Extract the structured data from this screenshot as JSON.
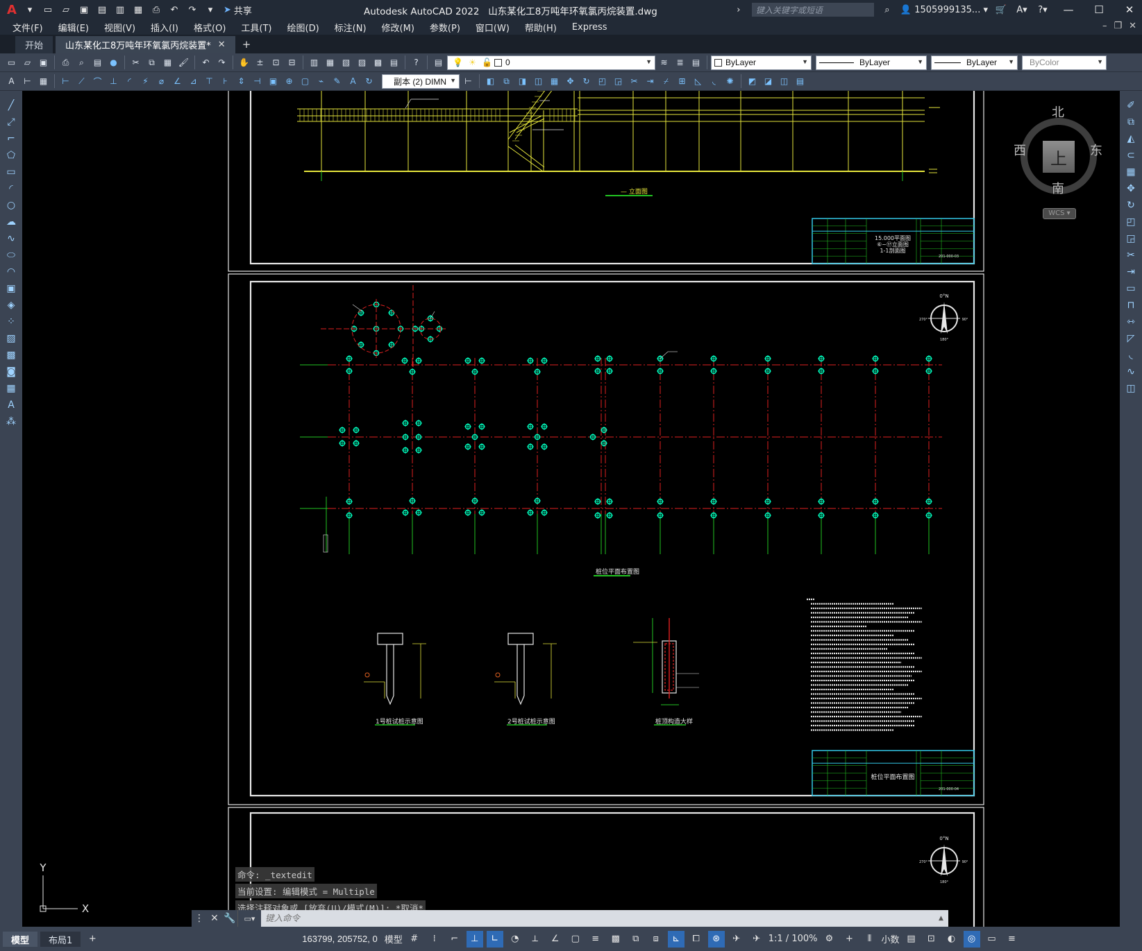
{
  "titlebar": {
    "app_title": "Autodesk AutoCAD 2022",
    "file_name": "山东某化工8万吨年环氧氯丙烷装置.dwg",
    "share_label": "共享",
    "search_placeholder": "键入关键字或短语",
    "user_name": "1505999135..."
  },
  "menu": {
    "items": [
      "文件(F)",
      "编辑(E)",
      "视图(V)",
      "插入(I)",
      "格式(O)",
      "工具(T)",
      "绘图(D)",
      "标注(N)",
      "修改(M)",
      "参数(P)",
      "窗口(W)",
      "帮助(H)",
      "Express"
    ]
  },
  "tabs": {
    "start": "开始",
    "active": "山东某化工8万吨年环氧氯丙烷装置*"
  },
  "toolbar": {
    "layer_value": "0",
    "color_value": "ByLayer",
    "linetype_value": "ByLayer",
    "lineweight_value": "ByLayer",
    "plotstyle_value": "ByColor",
    "dimstyle_value": "副本 (2) DIMN"
  },
  "viewcube": {
    "north": "北",
    "south": "南",
    "east": "东",
    "west": "西",
    "top_face": "上",
    "wcs": "WCS"
  },
  "drawing": {
    "sheet1": {
      "elevation_caption": "— 立面图",
      "title_block_lines": [
        "15.000平面图",
        "⑥~⑰立面图",
        "1-1剖面图"
      ],
      "drawing_no": "201-000-03"
    },
    "sheet2": {
      "pile_plan_caption": "桩位平面布置图",
      "detail1_caption": "1号桩试桩示意图",
      "detail2_caption": "2号桩试桩示意图",
      "detail3_caption": "桩顶构造大样",
      "title_block_title": "桩位平面布置图",
      "drawing_no": "201-000-04"
    },
    "compass": {
      "north": "0°N",
      "east": "90°",
      "west": "270°",
      "south": "180°"
    }
  },
  "ucs": {
    "x_label": "X",
    "y_label": "Y"
  },
  "command": {
    "history": [
      "命令: _textedit",
      "当前设置: 编辑模式 = Multiple",
      "选择注释对象或 [放弃(U)/模式(M)]: *取消*"
    ],
    "input_placeholder": "键入命令"
  },
  "status": {
    "model_tab": "模型",
    "layout_tab": "布局1",
    "coordinates": "163799, 205752, 0",
    "space": "模型",
    "scale": "1:1 / 100%",
    "units": "小数"
  },
  "colors": {
    "ui_dark": "#222a36",
    "ui_panel": "#3b4453",
    "frame_white": "#ffffff",
    "structure_yellow": "#e6e63c",
    "axis_red": "#e02020",
    "grid_green": "#22c422",
    "pile_cyan": "#00ffbf",
    "title_block_cyan": "#33c6e6"
  }
}
